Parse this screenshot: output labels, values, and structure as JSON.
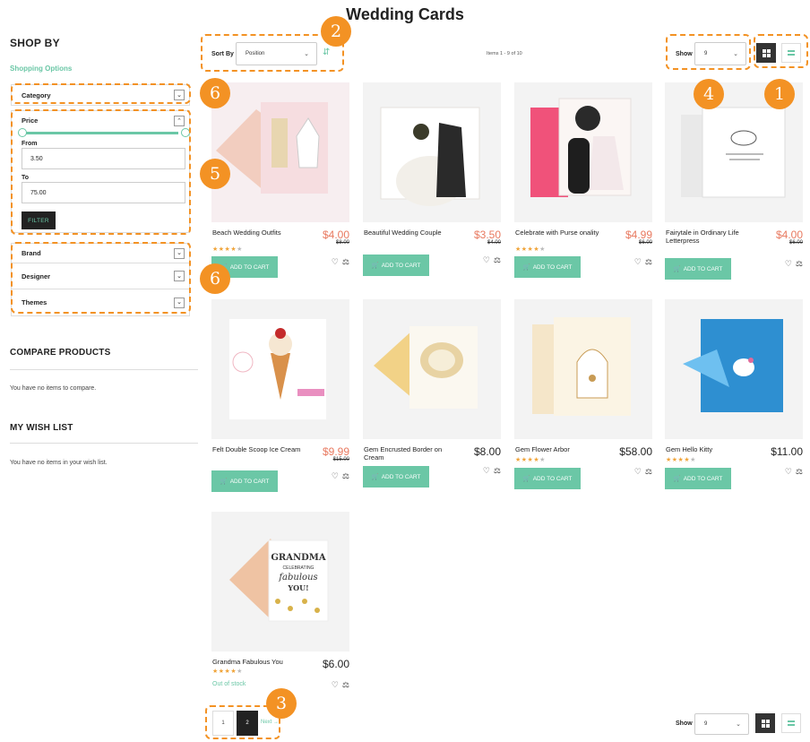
{
  "page": {
    "title": "Wedding Cards"
  },
  "sidebar": {
    "shop_by": "SHOP BY",
    "shopping_options": "Shopping Options",
    "category": "Category",
    "price": {
      "title": "Price",
      "from_label": "From",
      "from_value": "3.50",
      "to_label": "To",
      "to_value": "75.00",
      "filter_button": "FILTER"
    },
    "groups": [
      "Brand",
      "Designer",
      "Themes"
    ],
    "compare": {
      "title": "COMPARE PRODUCTS",
      "text": "You have no items to compare."
    },
    "wishlist": {
      "title": "MY WISH LIST",
      "text": "You have no items in your wish list."
    }
  },
  "toolbar": {
    "sort_label": "Sort By",
    "sort_value": "Position",
    "items_count": "Items 1 - 9 of 10",
    "show_label": "Show",
    "show_value": "9"
  },
  "products": [
    {
      "name": "Beach Wedding Outfits",
      "price": "$4.00",
      "old_price": "$8.00",
      "rating": 4,
      "action": "ADD TO CART"
    },
    {
      "name": "Beautiful Wedding Couple",
      "price": "$3.50",
      "old_price": "$4.00",
      "rating": 0,
      "action": "ADD TO CART"
    },
    {
      "name": "Celebrate with Purse onality",
      "price": "$4.99",
      "old_price": "$6.00",
      "rating": 4,
      "action": "ADD TO CART"
    },
    {
      "name": "Fairytale in Ordinary Life Letterpress",
      "price": "$4.00",
      "old_price": "$6.00",
      "rating": 0,
      "action": "ADD TO CART"
    },
    {
      "name": "Felt Double Scoop Ice Cream",
      "price": "$9.99",
      "old_price": "$15.00",
      "rating": 0,
      "action": "ADD TO CART"
    },
    {
      "name": "Gem Encrusted Border on Cream",
      "price": "$8.00",
      "old_price": "",
      "rating": 0,
      "action": "ADD TO CART"
    },
    {
      "name": "Gem Flower Arbor",
      "price": "$58.00",
      "old_price": "",
      "rating": 4,
      "action": "ADD TO CART"
    },
    {
      "name": "Gem Hello Kitty",
      "price": "$11.00",
      "old_price": "",
      "rating": 4,
      "action": "ADD TO CART"
    },
    {
      "name": "Grandma Fabulous You",
      "price": "$6.00",
      "old_price": "",
      "rating": 4,
      "status": "Out of stock"
    }
  ],
  "pagination": {
    "pages": [
      "1",
      "2"
    ],
    "current": "2",
    "next": "Next"
  },
  "card_art": {
    "grandma_line1": "GRANDMA",
    "grandma_line2": "CELEBRATING",
    "grandma_line3": "fabulous",
    "grandma_line4": "YOU!"
  },
  "annotations": [
    "1",
    "2",
    "3",
    "4",
    "5",
    "6",
    "6"
  ],
  "colors": {
    "accent": "#6bc7a6",
    "sale": "#e8795f",
    "annotation": "#f39224",
    "dark": "#222222"
  }
}
